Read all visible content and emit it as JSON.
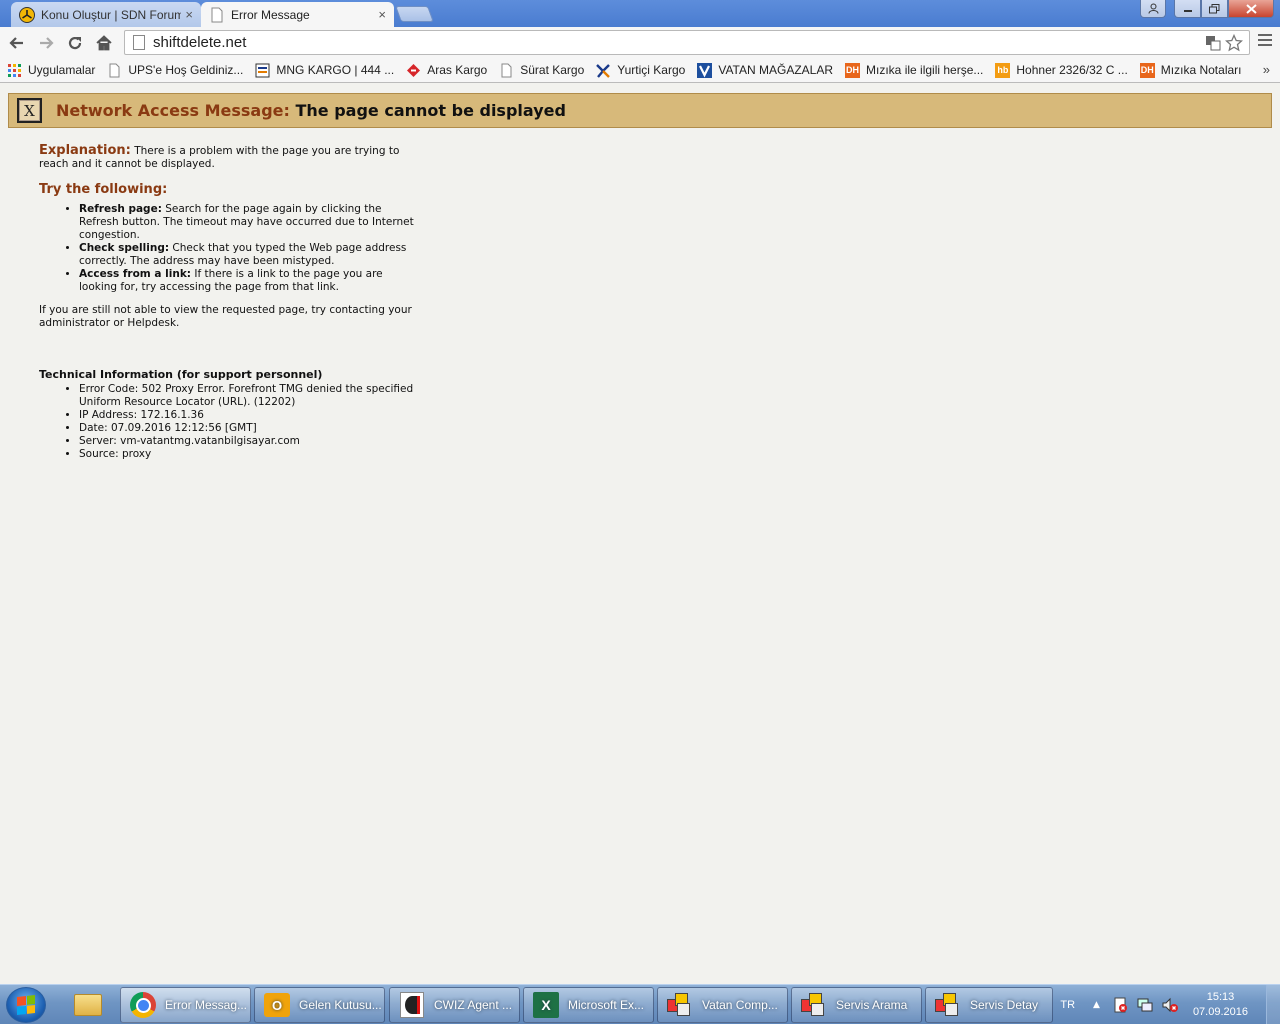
{
  "browser": {
    "tabs": [
      {
        "title": "Konu Oluştur | SDN Forum",
        "active": false
      },
      {
        "title": "Error Message",
        "active": true
      }
    ],
    "close_glyph": "×",
    "url": "shiftdelete.net",
    "bookmarks": [
      {
        "label": "Uygulamalar",
        "icon": "apps-grid-icon"
      },
      {
        "label": "UPS'e Hoş Geldiniz...",
        "icon": "page-icon"
      },
      {
        "label": "MNG KARGO | 444 ...",
        "icon": "mng-icon"
      },
      {
        "label": "Aras Kargo",
        "icon": "aras-icon"
      },
      {
        "label": "Sürat Kargo",
        "icon": "page-icon"
      },
      {
        "label": "Yurtiçi Kargo",
        "icon": "yurtici-icon"
      },
      {
        "label": "VATAN MAĞAZALAR",
        "icon": "vatan-icon"
      },
      {
        "label": "Mızıka ile ilgili herşe...",
        "icon": "dh-icon"
      },
      {
        "label": "Hohner 2326/32 C ...",
        "icon": "hb-icon"
      },
      {
        "label": "Mızıka Notaları",
        "icon": "dh-icon"
      }
    ],
    "more_bookmarks": "»"
  },
  "banner": {
    "label": "Network Access Message:",
    "message": "The page cannot be displayed",
    "close_glyph": "X"
  },
  "content": {
    "explanation_label": "Explanation:",
    "explanation_text": "There is a problem with the page you are trying to reach and it cannot be displayed.",
    "try_heading": "Try the following:",
    "tips": [
      {
        "label": "Refresh page:",
        "text": "Search for the page again by clicking the Refresh button. The timeout may have occurred due to Internet congestion."
      },
      {
        "label": "Check spelling:",
        "text": "Check that you typed the Web page address correctly. The address may have been mistyped."
      },
      {
        "label": "Access from a link:",
        "text": "If there is a link to the page you are looking for, try accessing the page from that link."
      }
    ],
    "still_text": "If you are still not able to view the requested page, try contacting your administrator or Helpdesk.",
    "tech_heading": "Technical Information (for support personnel)",
    "tech_items": [
      "Error Code: 502 Proxy Error. Forefront TMG denied the specified Uniform Resource Locator (URL). (12202)",
      "IP Address: 172.16.1.36",
      "Date: 07.09.2016 12:12:56 [GMT]",
      "Server: vm-vatantmg.vatanbilgisayar.com",
      "Source: proxy"
    ]
  },
  "taskbar": {
    "tasks": [
      {
        "label": "Error Messag...",
        "icon": "chrome-icon",
        "active": true
      },
      {
        "label": "Gelen Kutusu...",
        "icon": "outlook-icon",
        "active": false
      },
      {
        "label": "CWIZ Agent ...",
        "icon": "cwiz-icon",
        "active": false
      },
      {
        "label": "Microsoft Ex...",
        "icon": "excel-icon",
        "active": false
      },
      {
        "label": "Vatan Comp...",
        "icon": "vatan-app-icon",
        "active": false
      },
      {
        "label": "Servis Arama",
        "icon": "vatan-app-icon",
        "active": false
      },
      {
        "label": "Servis Detay",
        "icon": "vatan-app-icon",
        "active": false
      }
    ],
    "language": "TR",
    "time": "15:13",
    "date": "07.09.2016"
  },
  "colors": {
    "banner_bg": "#d7b97a",
    "heading_red": "#8a3a12",
    "page_bg": "#f2f2ee",
    "tab_strip": "#4a7cd0"
  }
}
